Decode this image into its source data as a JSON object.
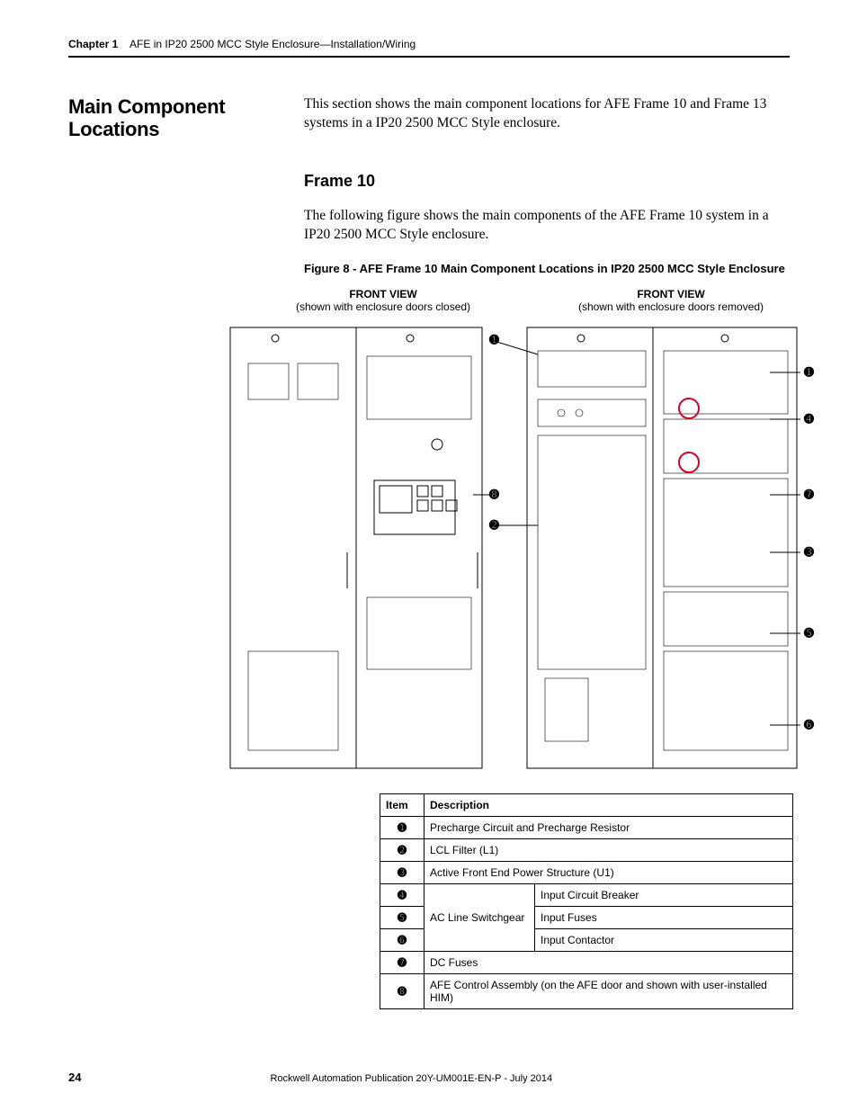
{
  "header": {
    "chapter": "Chapter 1",
    "title": "AFE in IP20 2500 MCC Style Enclosure—Installation/Wiring"
  },
  "sideHeading": "Main Component Locations",
  "introPara": "This section shows the main component locations for AFE Frame 10 and Frame 13 systems in a IP20 2500 MCC Style enclosure.",
  "subHeading": "Frame 10",
  "subPara": "The following figure shows the main components of the AFE Frame 10 system in a IP20 2500 MCC Style enclosure.",
  "figureCaption": "Figure 8 - AFE Frame 10 Main Component Locations in IP20 2500 MCC Style Enclosure",
  "views": {
    "left": {
      "title": "FRONT VIEW",
      "sub": "(shown with enclosure doors closed)"
    },
    "right": {
      "title": "FRONT VIEW",
      "sub": "(shown with enclosure doors removed)"
    }
  },
  "callouts": {
    "markers": [
      "➊",
      "➋",
      "➌",
      "➍",
      "➎",
      "➏",
      "➐",
      "➑"
    ]
  },
  "table": {
    "headers": [
      "Item",
      "Description"
    ],
    "midHeader": "AC Line Switchgear",
    "rows": [
      {
        "item": "➊",
        "desc": "Precharge Circuit and Precharge Resistor"
      },
      {
        "item": "➋",
        "desc": "LCL Filter (L1)"
      },
      {
        "item": "➌",
        "desc": "Active Front End Power Structure (U1)"
      },
      {
        "item": "➍",
        "desc": "Input Circuit Breaker"
      },
      {
        "item": "➎",
        "desc": "Input Fuses"
      },
      {
        "item": "➏",
        "desc": "Input Contactor"
      },
      {
        "item": "➐",
        "desc": "DC Fuses"
      },
      {
        "item": "➑",
        "desc": "AFE Control Assembly (on the AFE door and shown with user-installed HIM)"
      }
    ]
  },
  "footer": {
    "page": "24",
    "pub": "Rockwell Automation Publication 20Y-UM001E-EN-P - July 2014"
  }
}
